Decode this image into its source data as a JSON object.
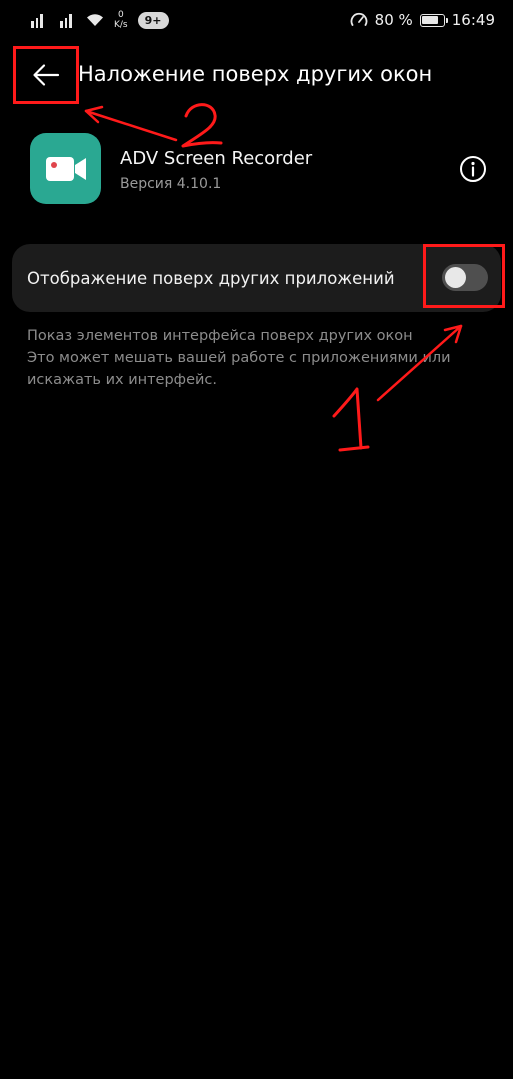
{
  "status_bar": {
    "signal_1_label": "",
    "signal_2_label": "",
    "net_speed_value": "0",
    "net_speed_unit": "K/s",
    "notification_badge": "9+",
    "battery_percent": "80 %",
    "time": "16:49"
  },
  "header": {
    "title": "Наложение поверх других окон"
  },
  "app": {
    "name": "ADV Screen Recorder",
    "version": "Версия 4.10.1",
    "icon": "video-camera-icon",
    "icon_color": "#2aa892"
  },
  "setting": {
    "label": "Отображение поверх других приложений",
    "enabled": false
  },
  "description": {
    "line1": "Показ элементов интерфейса поверх других окон",
    "line2": "Это может мешать вашей работе с приложениями или",
    "line3": "искажать их интерфейс."
  },
  "annotations": {
    "color": "#ff1a1a",
    "marker_1": "1",
    "marker_2": "2"
  }
}
